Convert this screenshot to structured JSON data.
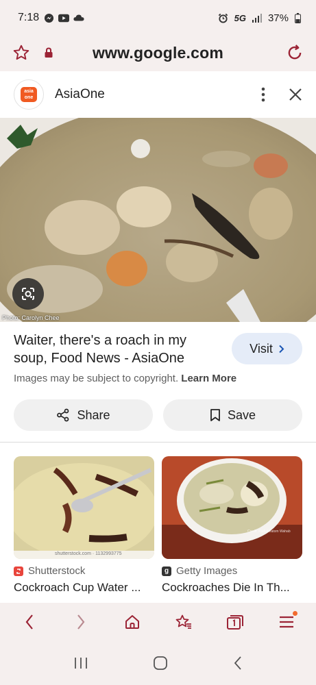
{
  "status_bar": {
    "time": "7:18",
    "network": "5G",
    "battery": "37%"
  },
  "browser": {
    "url": "www.google.com"
  },
  "result": {
    "source_name": "AsiaOne",
    "source_logo_text_1": "asia",
    "source_logo_text_2": "one",
    "photo_credit": "Photo: Carolyn Chee",
    "title": "Waiter, there's a roach in my soup, Food News - AsiaOne",
    "visit_label": "Visit",
    "copyright_text": "Images may be subject to copyright.",
    "learn_more": "Learn More",
    "share_label": "Share",
    "save_label": "Save"
  },
  "related": [
    {
      "source": "Shutterstock",
      "title": "Cockroach Cup Water ...",
      "badge_color": "#e8453c",
      "watermark": "shutterstock.com · 1132993775"
    },
    {
      "source": "Getty Images",
      "title": "Cockroaches Die In Th...",
      "badge_color": "#333333",
      "badge_letter": "g",
      "watermark": "Credit: Radiokhatom Wahab"
    }
  ],
  "colors": {
    "accent": "#9b2335",
    "visit_bg": "#e5ecf8",
    "notification": "#f26a2e"
  }
}
